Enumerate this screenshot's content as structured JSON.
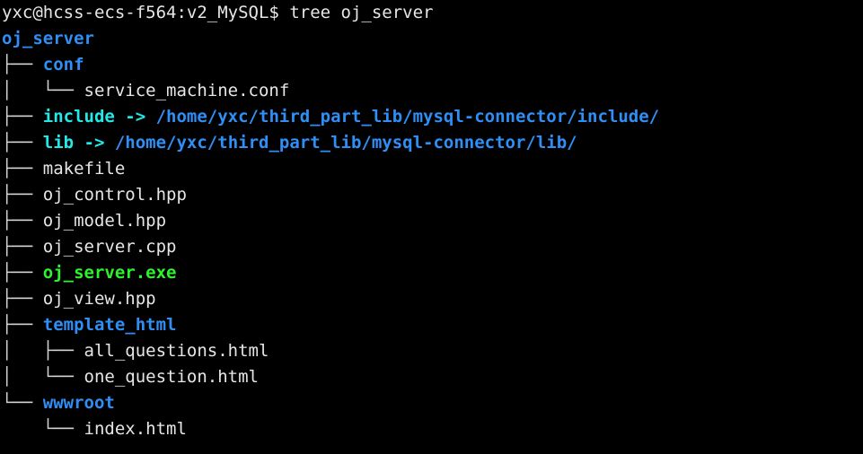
{
  "terminal": {
    "background_color": "#000000",
    "foreground_color": "#e6e6e6",
    "colors": {
      "directory": "#2f8ff5",
      "symlink": "#22e8e8",
      "executable": "#2ef22e",
      "tree_lines": "#d4d4d4",
      "default_text": "#e6e6e6"
    },
    "prompt": {
      "user_host_path": "yxc@hcss-ecs-f564:v2_MySQL",
      "symbol": "$",
      "command": "tree oj_server",
      "full_line": "yxc@hcss-ecs-f564:v2_MySQL$ tree oj_server"
    },
    "tree": {
      "root": {
        "name": "oj_server",
        "type": "directory"
      },
      "entries": [
        {
          "prefix": "├── ",
          "name": "conf",
          "type": "directory",
          "depth": 1
        },
        {
          "prefix": "│   └── ",
          "name": "service_machine.conf",
          "type": "file",
          "depth": 2
        },
        {
          "prefix": "├── ",
          "name": "include",
          "type": "symlink",
          "arrow": " -> ",
          "target": "/home/yxc/third_part_lib/mysql-connector/include/",
          "depth": 1
        },
        {
          "prefix": "├── ",
          "name": "lib",
          "type": "symlink",
          "arrow": " -> ",
          "target": "/home/yxc/third_part_lib/mysql-connector/lib/",
          "depth": 1
        },
        {
          "prefix": "├── ",
          "name": "makefile",
          "type": "file",
          "depth": 1
        },
        {
          "prefix": "├── ",
          "name": "oj_control.hpp",
          "type": "file",
          "depth": 1
        },
        {
          "prefix": "├── ",
          "name": "oj_model.hpp",
          "type": "file",
          "depth": 1
        },
        {
          "prefix": "├── ",
          "name": "oj_server.cpp",
          "type": "file",
          "depth": 1
        },
        {
          "prefix": "├── ",
          "name": "oj_server.exe",
          "type": "executable",
          "depth": 1
        },
        {
          "prefix": "├── ",
          "name": "oj_view.hpp",
          "type": "file",
          "depth": 1
        },
        {
          "prefix": "├── ",
          "name": "template_html",
          "type": "directory",
          "depth": 1
        },
        {
          "prefix": "│   ├── ",
          "name": "all_questions.html",
          "type": "file",
          "depth": 2
        },
        {
          "prefix": "│   └── ",
          "name": "one_question.html",
          "type": "file",
          "depth": 2
        },
        {
          "prefix": "└── ",
          "name": "wwwroot",
          "type": "directory",
          "depth": 1
        },
        {
          "prefix": "    └── ",
          "name": "index.html",
          "type": "file",
          "depth": 2
        }
      ]
    }
  }
}
